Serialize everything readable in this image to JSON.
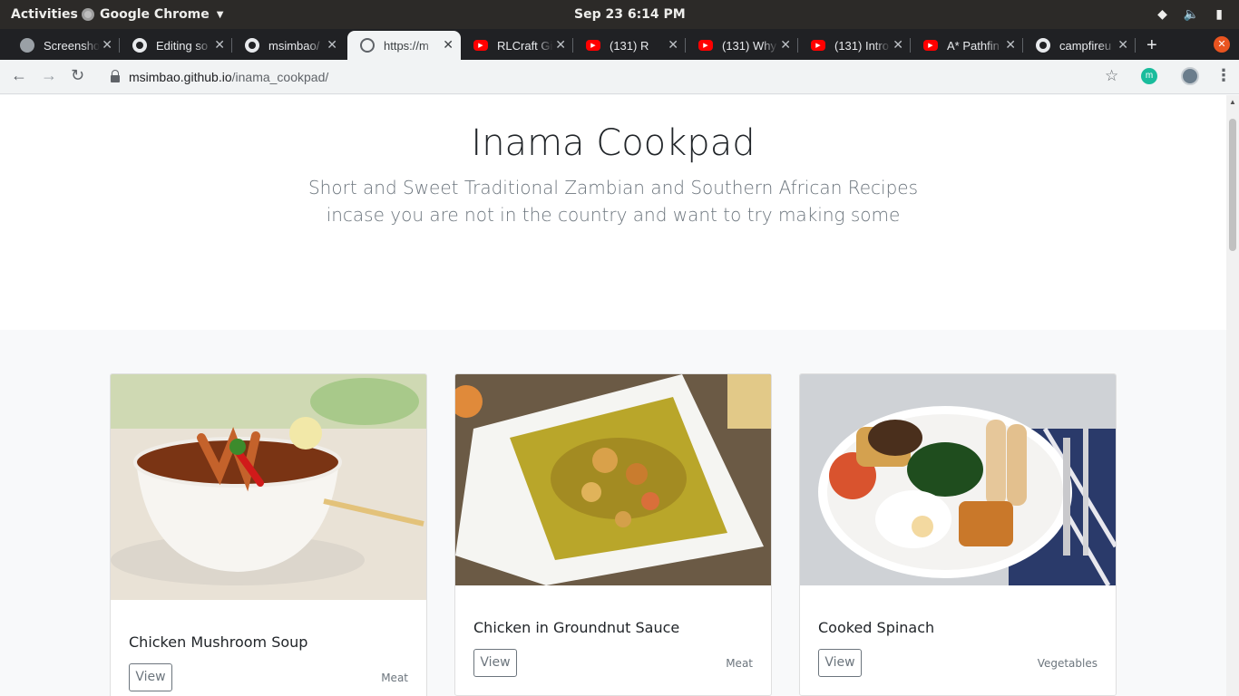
{
  "system_bar": {
    "activities": "Activities",
    "app_name": "Google Chrome",
    "clock": "Sep 23   6:14 PM"
  },
  "browser": {
    "tabs": [
      {
        "title": "Screenshot",
        "icon": "screenshot-icon",
        "active": false
      },
      {
        "title": "Editing so",
        "icon": "github-icon",
        "active": false
      },
      {
        "title": "msimbao/",
        "icon": "github-icon",
        "active": false
      },
      {
        "title": "https://m",
        "icon": "globe-icon",
        "active": true
      },
      {
        "title": "RLCraft Gi",
        "icon": "youtube-icon",
        "active": false
      },
      {
        "title": "(131) R",
        "icon": "youtube-icon",
        "active": false
      },
      {
        "title": "(131) Why",
        "icon": "youtube-icon",
        "active": false
      },
      {
        "title": "(131) Intro",
        "icon": "youtube-icon",
        "active": false
      },
      {
        "title": "A* Pathfin",
        "icon": "youtube-icon",
        "active": false
      },
      {
        "title": "campfireu",
        "icon": "github-icon",
        "active": false
      }
    ],
    "url_host": "msimbao.github.io",
    "url_path": "/inama_cookpad/",
    "extension_badge": "m"
  },
  "page": {
    "title": "Inama Cookpad",
    "subtitle_line1": "Short and Sweet Traditional Zambian and Southern African Recipes",
    "subtitle_line2": "incase you are not in the country and want to try making some",
    "cards": [
      {
        "title": "Chicken Mushroom Soup",
        "button": "View",
        "tag": "Meat"
      },
      {
        "title": "Chicken in Groundnut Sauce",
        "button": "View",
        "tag": "Meat"
      },
      {
        "title": "Cooked Spinach",
        "button": "View",
        "tag": "Vegetables"
      }
    ]
  },
  "colors": {
    "accent_close": "#e95420",
    "youtube": "#ff0000",
    "muted_text": "#6c757d"
  }
}
